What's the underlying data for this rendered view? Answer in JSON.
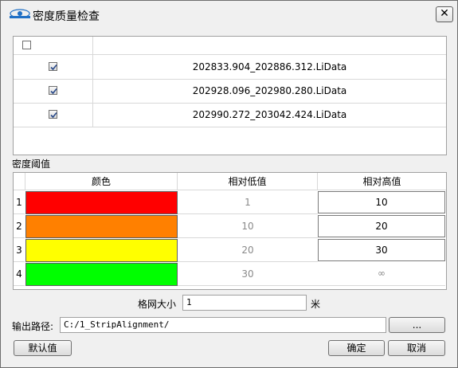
{
  "dialog": {
    "title": "密度质量检查",
    "close_label": "✕"
  },
  "file_list": {
    "header_checked": false,
    "rows": [
      {
        "checked": true,
        "name": "202833.904_202886.312.LiData"
      },
      {
        "checked": true,
        "name": "202928.096_202980.280.LiData"
      },
      {
        "checked": true,
        "name": "202990.272_203042.424.LiData"
      }
    ]
  },
  "threshold": {
    "section_label": "密度阈值",
    "columns": [
      "颜色",
      "相对低值",
      "相对高值"
    ],
    "rows": [
      {
        "index": "1",
        "color": "#ff0000",
        "low": "1",
        "high": "10"
      },
      {
        "index": "2",
        "color": "#ff8000",
        "low": "10",
        "high": "20"
      },
      {
        "index": "3",
        "color": "#ffff00",
        "low": "20",
        "high": "30"
      },
      {
        "index": "4",
        "color": "#00ff00",
        "low": "30",
        "high": "∞"
      }
    ]
  },
  "grid_size": {
    "label": "格网大小",
    "value": "1",
    "unit": "米"
  },
  "output": {
    "label": "输出路径:",
    "value": "C:/1_StripAlignment/",
    "browse_label": "..."
  },
  "buttons": {
    "default": "默认值",
    "ok": "确定",
    "cancel": "取消"
  }
}
